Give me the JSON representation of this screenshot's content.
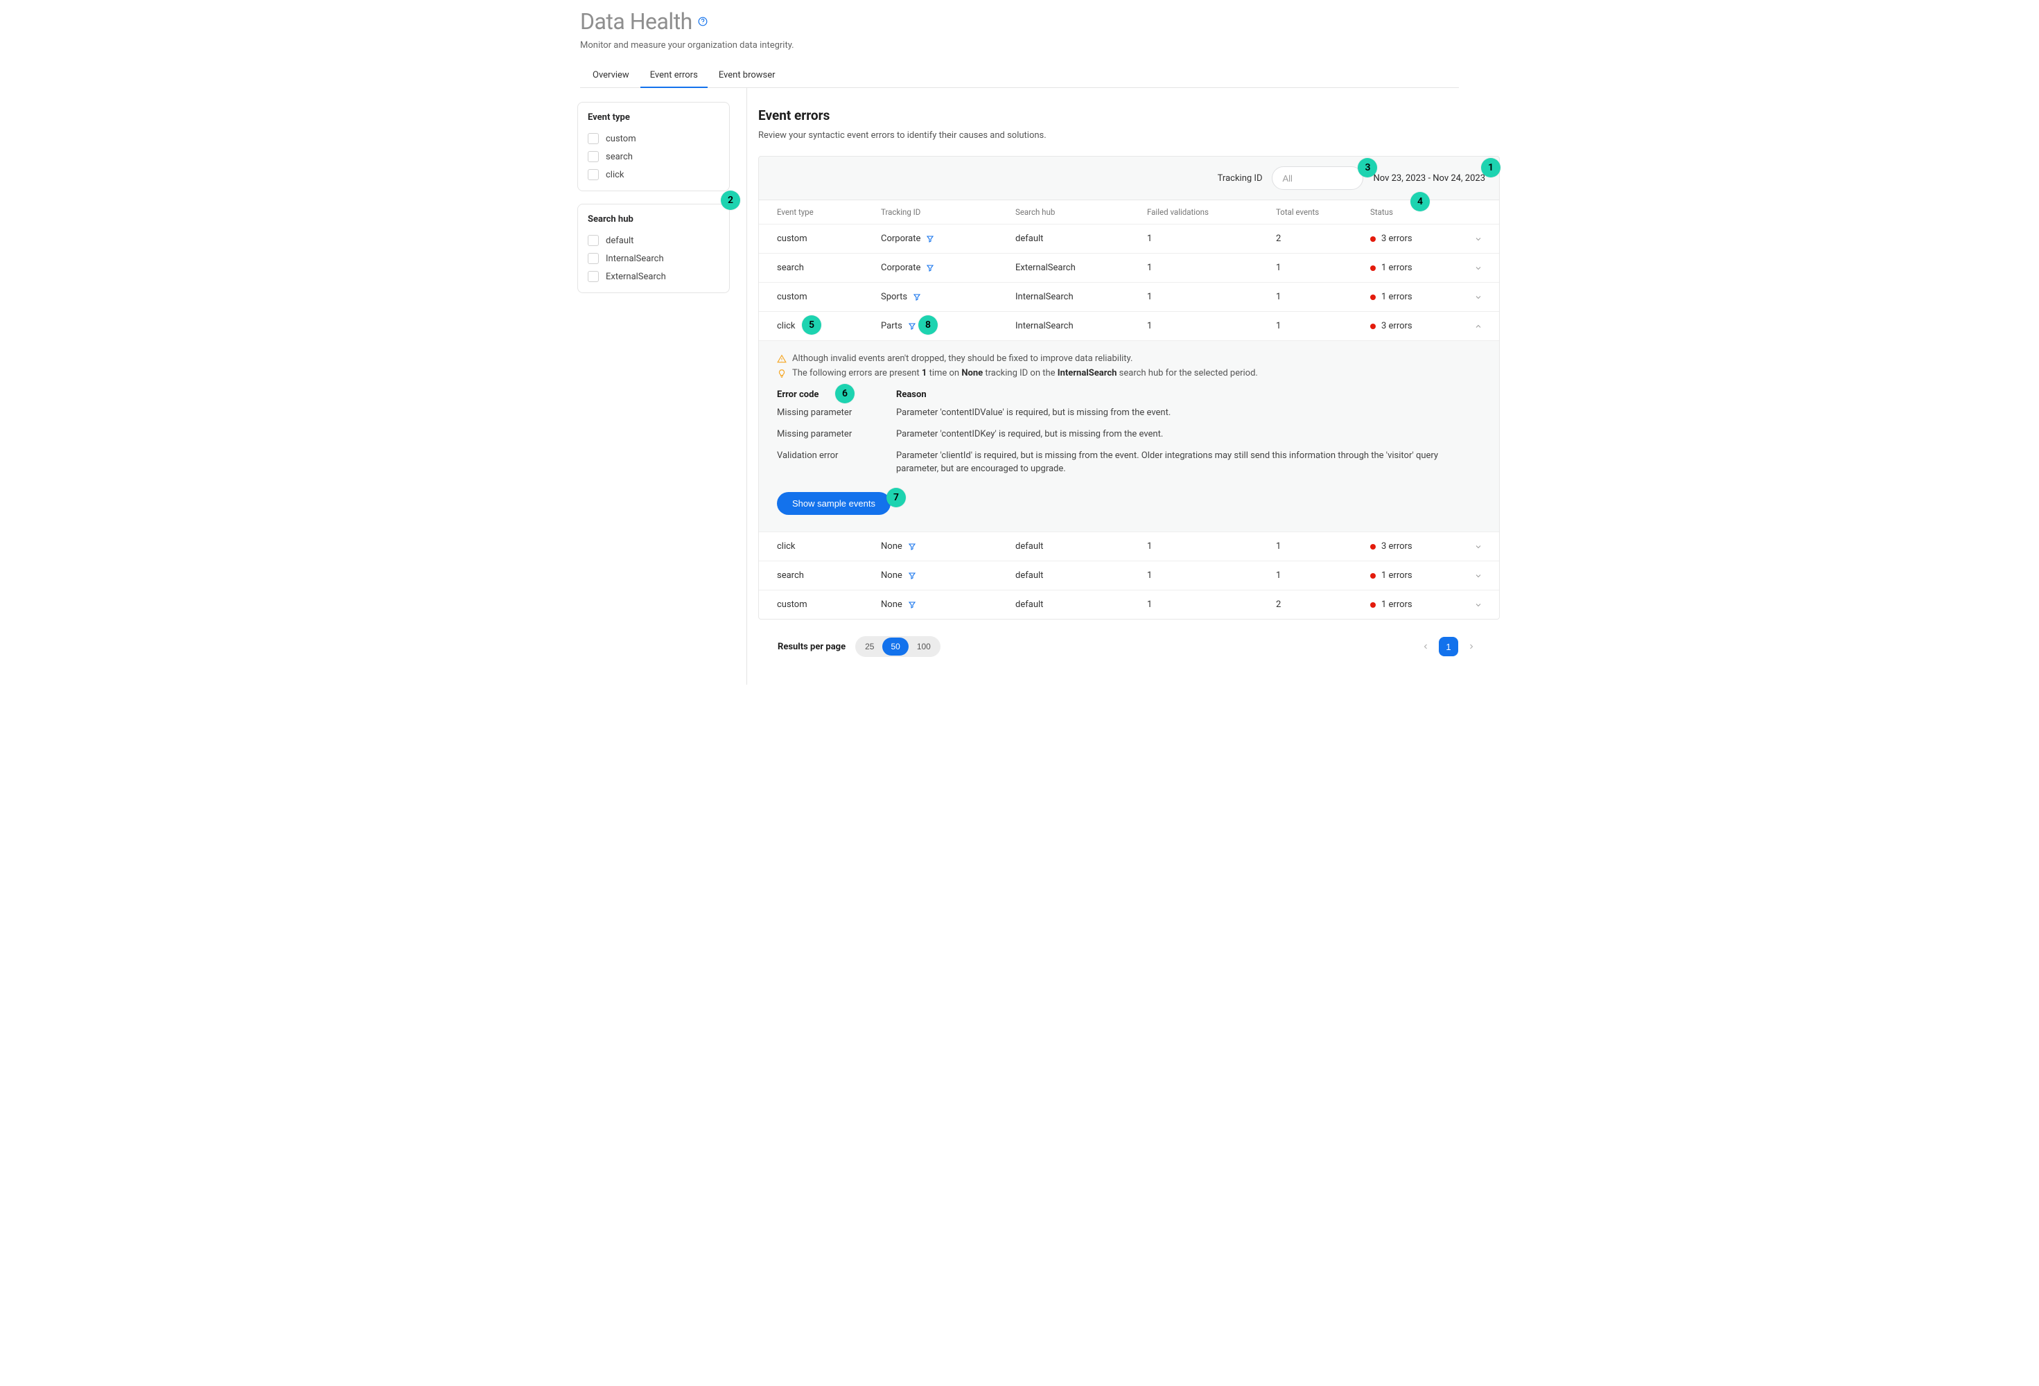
{
  "header": {
    "title": "Data Health",
    "subtitle": "Monitor and measure your organization data integrity."
  },
  "tabs": {
    "overview": "Overview",
    "event_errors": "Event errors",
    "event_browser": "Event browser"
  },
  "facets": {
    "event_type": {
      "title": "Event type",
      "options": [
        "custom",
        "search",
        "click"
      ]
    },
    "search_hub": {
      "title": "Search hub",
      "options": [
        "default",
        "InternalSearch",
        "ExternalSearch"
      ]
    }
  },
  "section": {
    "title": "Event errors",
    "subtitle": "Review your syntactic event errors to identify their causes and solutions."
  },
  "filters": {
    "tracking_label": "Tracking ID",
    "tracking_placeholder": "All",
    "date_range": "Nov 23, 2023 - Nov 24, 2023"
  },
  "columns": {
    "event_type": "Event type",
    "tracking_id": "Tracking ID",
    "search_hub": "Search hub",
    "failed": "Failed validations",
    "total": "Total events",
    "status": "Status"
  },
  "rows": [
    {
      "event_type": "custom",
      "tracking_id": "Corporate",
      "search_hub": "default",
      "failed": "1",
      "total": "2",
      "status": "3 errors",
      "expanded": false
    },
    {
      "event_type": "search",
      "tracking_id": "Corporate",
      "search_hub": "ExternalSearch",
      "failed": "1",
      "total": "1",
      "status": "1 errors",
      "expanded": false
    },
    {
      "event_type": "custom",
      "tracking_id": "Sports",
      "search_hub": "InternalSearch",
      "failed": "1",
      "total": "1",
      "status": "1 errors",
      "expanded": false
    },
    {
      "event_type": "click",
      "tracking_id": "Parts",
      "search_hub": "InternalSearch",
      "failed": "1",
      "total": "1",
      "status": "3 errors",
      "expanded": true
    },
    {
      "event_type": "click",
      "tracking_id": "None",
      "search_hub": "default",
      "failed": "1",
      "total": "1",
      "status": "3 errors",
      "expanded": false
    },
    {
      "event_type": "search",
      "tracking_id": "None",
      "search_hub": "default",
      "failed": "1",
      "total": "1",
      "status": "1 errors",
      "expanded": false
    },
    {
      "event_type": "custom",
      "tracking_id": "None",
      "search_hub": "default",
      "failed": "1",
      "total": "2",
      "status": "1 errors",
      "expanded": false
    }
  ],
  "detail": {
    "warn": "Although invalid events aren't dropped, they should be fixed to improve data reliability.",
    "info_pre": "The following errors are present ",
    "info_count": "1",
    "info_mid1": " time on ",
    "info_tracking": "None",
    "info_mid2": " tracking ID on the ",
    "info_hub": "InternalSearch",
    "info_post": " search hub for the selected period.",
    "code_label": "Error code",
    "reason_label": "Reason",
    "errors": [
      {
        "code": "Missing parameter",
        "reason": "Parameter 'contentIDValue' is required, but is missing from the event."
      },
      {
        "code": "Missing parameter",
        "reason": "Parameter 'contentIDKey' is required, but is missing from the event."
      },
      {
        "code": "Validation error",
        "reason": "Parameter 'clientId' is required, but is missing from the event. Older integrations may still send this information through the 'visitor' query parameter, but are encouraged to upgrade."
      }
    ],
    "button": "Show sample events"
  },
  "pagination": {
    "rpp_label": "Results per page",
    "options": [
      "25",
      "50",
      "100"
    ],
    "current_page": "1"
  },
  "bubbles": {
    "b1": "1",
    "b2": "2",
    "b3": "3",
    "b4": "4",
    "b5": "5",
    "b6": "6",
    "b7": "7",
    "b8": "8"
  }
}
